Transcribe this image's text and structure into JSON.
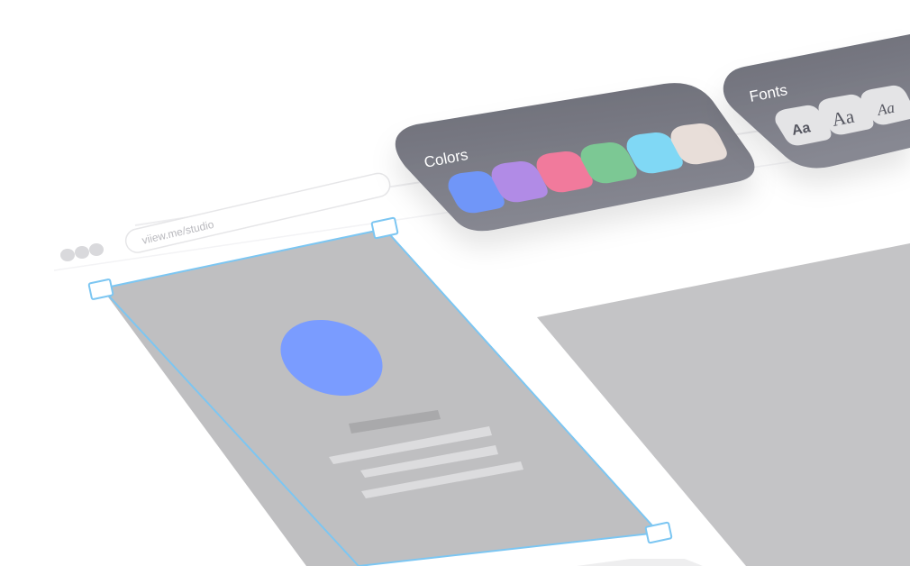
{
  "browser": {
    "address": "viiew.me/studio",
    "window_dots": 3
  },
  "colors_panel": {
    "title": "Colors",
    "swatches": [
      {
        "name": "blue",
        "hex": "#7096F8"
      },
      {
        "name": "purple",
        "hex": "#B18BE6"
      },
      {
        "name": "pink",
        "hex": "#F17A9C"
      },
      {
        "name": "green",
        "hex": "#7CC894"
      },
      {
        "name": "light-blue",
        "hex": "#80D8F5"
      },
      {
        "name": "beige",
        "hex": "#E8DED9"
      }
    ]
  },
  "fonts_panel": {
    "title": "Fonts",
    "samples": [
      "Aa",
      "Aa",
      "Aa"
    ]
  },
  "theme": {
    "panel_color": "#7A7B85",
    "selection_color": "#7CC6F2",
    "placeholder_color": "#C2C2C4",
    "avatar_color": "#7A9CFF"
  }
}
